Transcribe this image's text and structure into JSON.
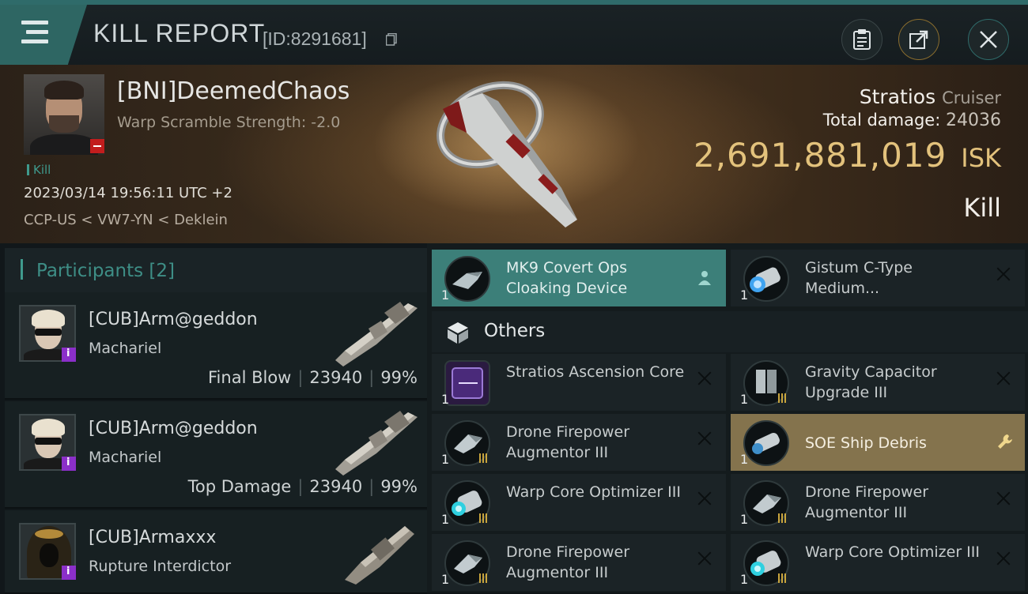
{
  "header": {
    "title": "KILL REPORT",
    "kill_id": "[ID:8291681]"
  },
  "victim": {
    "name": "[BNI]DeemedChaos",
    "scram": "Warp Scramble Strength: -2.0",
    "tag": "Kill",
    "datetime": "2023/03/14 19:56:11 UTC +2",
    "location": "CCP-US < VW7-YN < Deklein",
    "ship_name": "Stratios",
    "ship_class": "Cruiser",
    "total_damage_label": "Total damage:",
    "total_damage": "24036",
    "isk_value": "2,691,881,019",
    "isk_unit": "ISK",
    "result": "Kill"
  },
  "participants": {
    "title": "Participants [2]",
    "rows": [
      {
        "name": "[CUB]Arm@geddon",
        "ship": "Machariel",
        "role": "Final Blow",
        "damage": "23940",
        "percent": "99%"
      },
      {
        "name": "[CUB]Arm@geddon",
        "ship": "Machariel",
        "role": "Top Damage",
        "damage": "23940",
        "percent": "99%"
      },
      {
        "name": "[CUB]Armaxxx",
        "ship": "Rupture Interdictor"
      }
    ]
  },
  "modules": {
    "section_title": "Others",
    "top": [
      {
        "qty": "1",
        "name": "MK9 Covert Ops Cloaking Device",
        "state": "teal"
      },
      {
        "qty": "1",
        "name": "Gistum C-Type Medium...",
        "state": "destroyed"
      }
    ],
    "others": [
      {
        "qty": "1",
        "name": "Stratios Ascension Core",
        "state": "destroyed"
      },
      {
        "qty": "1",
        "name": "Gravity Capacitor Upgrade III",
        "state": "destroyed"
      },
      {
        "qty": "1",
        "name": "Drone Firepower Augmentor III",
        "state": "destroyed"
      },
      {
        "qty": "1",
        "name": "SOE Ship Debris",
        "state": "gold"
      },
      {
        "qty": "1",
        "name": "Warp Core Optimizer III",
        "state": "destroyed"
      },
      {
        "qty": "1",
        "name": "Drone Firepower Augmentor III",
        "state": "destroyed"
      },
      {
        "qty": "1",
        "name": "Drone Firepower Augmentor III",
        "state": "destroyed"
      },
      {
        "qty": "1",
        "name": "Warp Core Optimizer III",
        "state": "destroyed"
      }
    ]
  },
  "colors": {
    "accent_teal": "#3c7f79",
    "isk_gold": "#e3c27c",
    "dropped_gold": "#84734d",
    "danger_red": "#c21d1d",
    "badge_purple": "#8b2fc9"
  },
  "icons": [
    "menu-icon",
    "clipboard-icon",
    "share-icon",
    "close-icon",
    "copy-icon",
    "cube-icon",
    "person-icon",
    "wrench-icon",
    "destroyed-x-icon"
  ]
}
